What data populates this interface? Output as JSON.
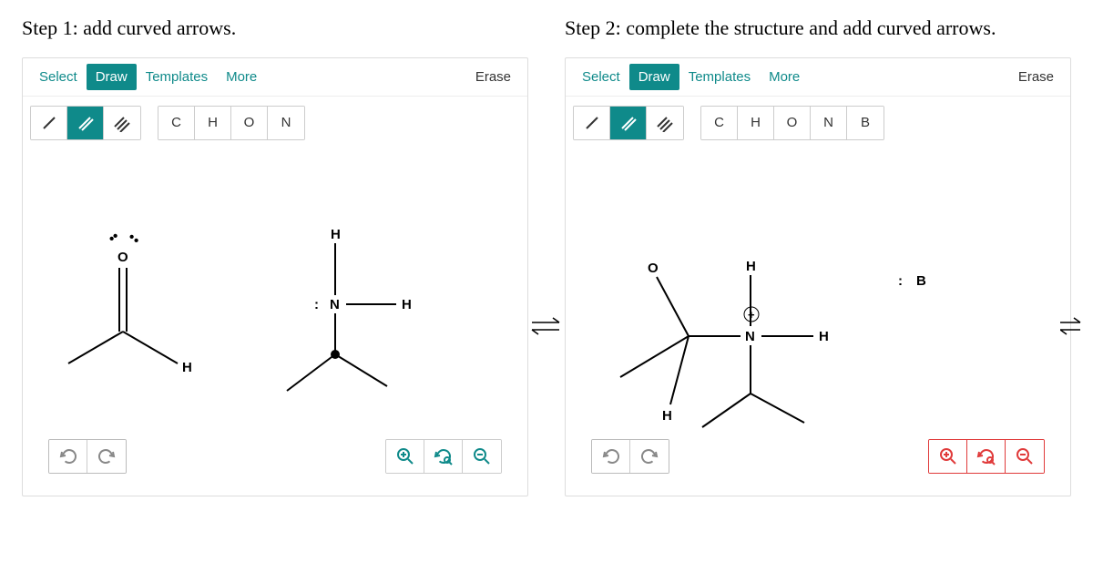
{
  "steps": [
    {
      "title": "Step 1: add curved arrows."
    },
    {
      "title": "Step 2: complete the structure and add curved arrows."
    }
  ],
  "tabs": {
    "select": "Select",
    "draw": "Draw",
    "templates": "Templates",
    "more": "More",
    "erase": "Erase"
  },
  "bonds": {
    "single": "/",
    "double": "//",
    "triple": "///"
  },
  "atoms": {
    "C": "C",
    "H": "H",
    "O": "O",
    "N": "N",
    "B": "B"
  },
  "molecule1": {
    "labels": {
      "O": "O",
      "H_right": "H",
      "N": "N",
      "H_top": "H",
      "H_side": "H",
      "lone_pair": ":",
      "oxy_dots_left": "•",
      "oxy_dots_right": "•"
    }
  },
  "molecule2": {
    "labels": {
      "O": "O",
      "H_top": "H",
      "H_bottom": "H",
      "N": "N",
      "H_side": "H",
      "B": "B",
      "lone_B": ":",
      "plus": "+"
    }
  }
}
